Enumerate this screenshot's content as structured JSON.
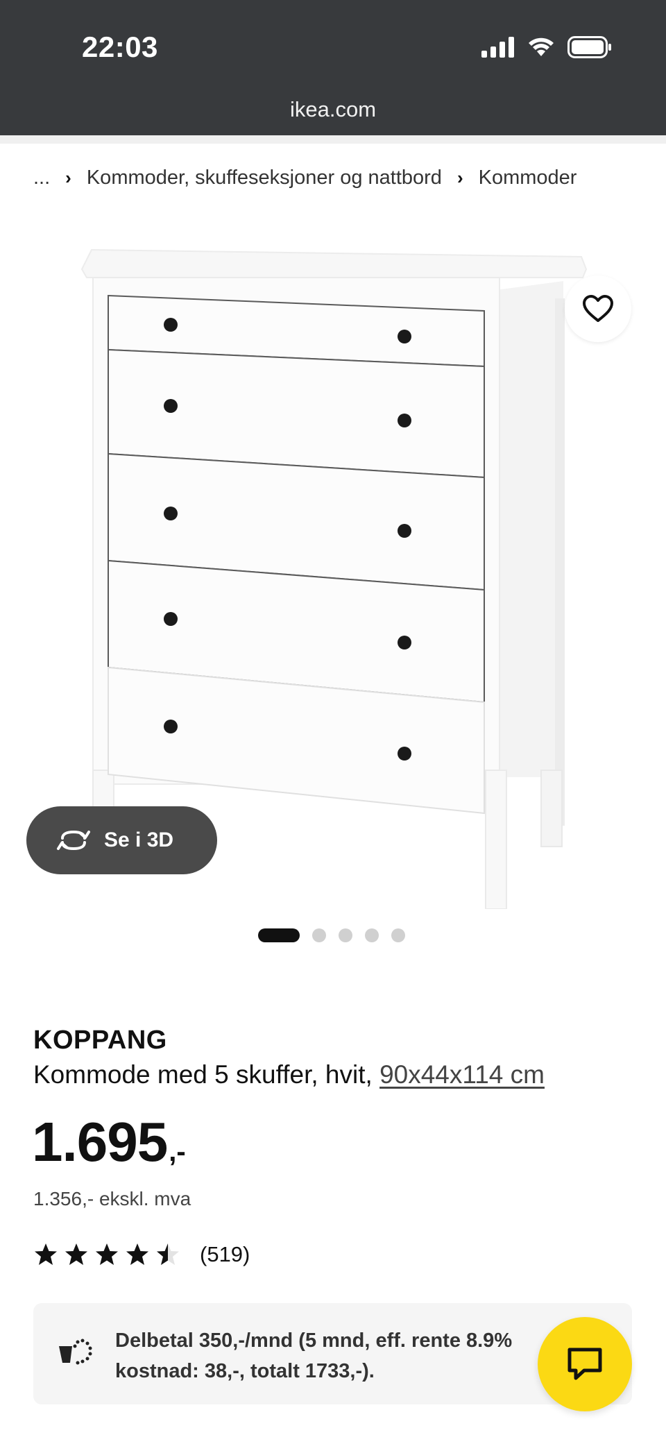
{
  "status_bar": {
    "time": "22:03"
  },
  "browser": {
    "url": "ikea.com"
  },
  "breadcrumb": {
    "ellipsis": "...",
    "items": [
      "Kommoder, skuffeseksjoner og nattbord",
      "Kommoder"
    ]
  },
  "gallery": {
    "image_description_icon": "white-five-drawer-dresser",
    "view_3d_label": "Se i 3D",
    "pages_total": 5,
    "page_active": 1
  },
  "product": {
    "brand": "KOPPANG",
    "description": "Kommode med 5 skuffer, hvit, ",
    "measurements": "90x44x114 cm",
    "price": "1.695",
    "price_suffix": ",-",
    "price_ex_vat": "1.356,- ekskl. mva",
    "rating_stars": 4.5,
    "rating_count": "(519)"
  },
  "installment": {
    "icon": "payment-installment-icon",
    "line1": "Delbetal 350,-/mnd (5 mnd, eff. rente 8.9%",
    "line2": "kostnad: 38,-, totalt 1733,-)."
  },
  "chat": {
    "icon": "chat-icon"
  },
  "colors": {
    "topbar": "#383a3d",
    "chat_button": "#fbd914",
    "text": "#111111"
  }
}
